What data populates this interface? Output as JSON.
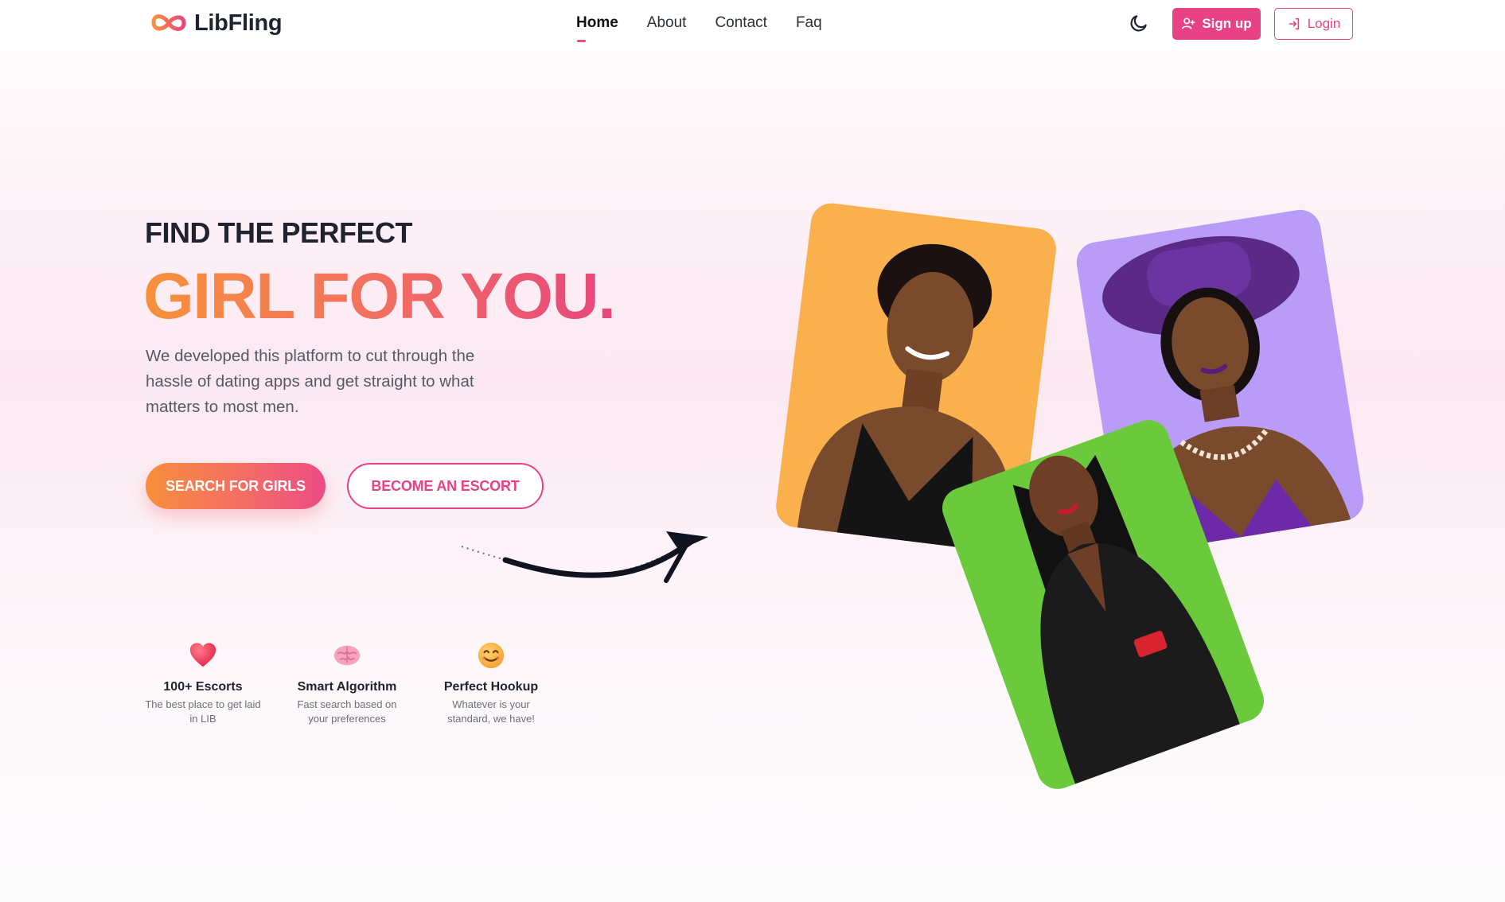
{
  "brand": {
    "name": "LibFling"
  },
  "nav": {
    "items": [
      {
        "label": "Home",
        "active": true
      },
      {
        "label": "About",
        "active": false
      },
      {
        "label": "Contact",
        "active": false
      },
      {
        "label": "Faq",
        "active": false
      }
    ],
    "signup_label": "Sign up",
    "login_label": "Login"
  },
  "hero": {
    "eyebrow": "FIND THE PERFECT",
    "title": "GIRL FOR YOU.",
    "description": "We developed this platform to cut through the hassle of dating apps and get straight to what matters to most men.",
    "primary_cta": "SEARCH FOR GIRLS",
    "secondary_cta": "BECOME AN ESCORT"
  },
  "features": [
    {
      "icon": "heart-icon",
      "title": "100+ Escorts",
      "desc": "The best place to get laid in LIB"
    },
    {
      "icon": "brain-icon",
      "title": "Smart Algorithm",
      "desc": "Fast search based on your preferences"
    },
    {
      "icon": "smile-icon",
      "title": "Perfect Hookup",
      "desc": "Whatever is your standard, we have!"
    }
  ],
  "colors": {
    "accent": "#e84286",
    "gradient_start": "#f7913a",
    "gradient_end": "#e8467e",
    "card_orange": "#f9b04d",
    "card_purple": "#b99bf8",
    "card_green": "#6bc93c"
  }
}
